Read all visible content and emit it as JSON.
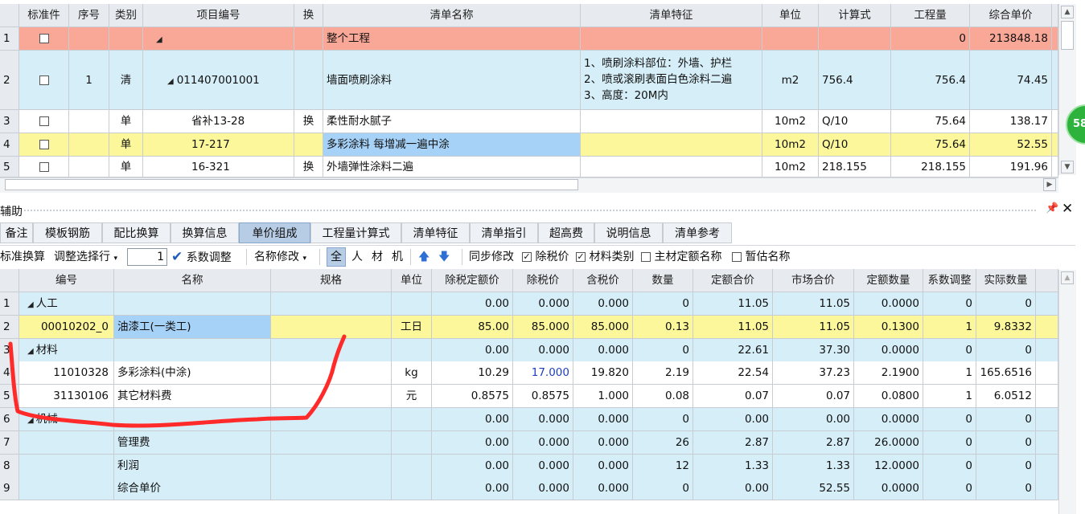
{
  "top": {
    "headers": [
      "标准件",
      "序号",
      "类别",
      "项目编号",
      "换",
      "清单名称",
      "清单特征",
      "单位",
      "计算式",
      "工程量",
      "综合单价"
    ],
    "rows": [
      {
        "rownum": "1",
        "seq": "",
        "type": "",
        "code": "",
        "swap": "",
        "name": "整个工程",
        "feature": [],
        "unit": "",
        "formula": "",
        "qty": "0",
        "price": "213848.18"
      },
      {
        "rownum": "2",
        "seq": "1",
        "type": "清",
        "code": "011407001001",
        "swap": "",
        "name": "墙面喷刷涂料",
        "feature": [
          "1、喷刷涂料部位：外墙、护栏",
          "2、喷或滚刷表面白色涂料二遍",
          "3、高度：20M内"
        ],
        "unit": "m2",
        "formula": "756.4",
        "qty": "756.4",
        "price": "74.45"
      },
      {
        "rownum": "3",
        "seq": "",
        "type": "单",
        "code": "省补13-28",
        "swap": "换",
        "name": "柔性耐水腻子",
        "feature": [],
        "unit": "10m2",
        "formula": "Q/10",
        "qty": "75.64",
        "price": "138.17"
      },
      {
        "rownum": "4",
        "seq": "",
        "type": "单",
        "code": "17-217",
        "swap": "",
        "name": "多彩涂料 每增减一遍中涂",
        "feature": [],
        "unit": "10m2",
        "formula": "Q/10",
        "qty": "75.64",
        "price": "52.55"
      },
      {
        "rownum": "5",
        "seq": "",
        "type": "单",
        "code": "16-321",
        "swap": "换",
        "name": "外墙弹性涂料二遍",
        "feature": [],
        "unit": "10m2",
        "formula": "218.155",
        "qty": "218.155",
        "price": "191.96"
      }
    ]
  },
  "badge": "58",
  "panel": {
    "title": "辅助",
    "pin_icon": "pin-icon",
    "close_icon": "close-icon"
  },
  "tabs": [
    "备注",
    "模板钢筋",
    "配比换算",
    "换算信息",
    "单价组成",
    "工程量计算式",
    "清单特征",
    "清单指引",
    "超高费",
    "说明信息",
    "清单参考"
  ],
  "active_tab": "单价组成",
  "toolbar": {
    "std_convert": "标准换算",
    "adjust_row": "调整选择行",
    "adjust_value": "1",
    "coef_adjust": "系数调整",
    "name_modify": "名称修改",
    "filters": [
      "全",
      "人",
      "材",
      "机"
    ],
    "sync_modify": "同步修改",
    "tax_price": "除税价",
    "material_cat": "材料类别",
    "main_quota_name": "主材定额名称",
    "prov_name": "暂估名称"
  },
  "bottom": {
    "headers": [
      "编号",
      "名称",
      "规格",
      "单位",
      "除税定额价",
      "除税价",
      "含税价",
      "数量",
      "定额合价",
      "市场合价",
      "定额数量",
      "系数调整",
      "实际数量"
    ],
    "rows": [
      {
        "rownum": "1",
        "code": "人工",
        "group": true,
        "name": "",
        "spec": "",
        "unit": "",
        "a": "0.00",
        "b": "0.000",
        "c": "0.000",
        "d": "0",
        "e": "11.05",
        "f": "11.05",
        "g": "0.0000",
        "h": "0",
        "i": "0"
      },
      {
        "rownum": "2",
        "code": "00010202_0",
        "group": false,
        "name": "油漆工(一类工)",
        "spec": "",
        "unit": "工日",
        "a": "85.00",
        "b": "85.000",
        "c": "85.000",
        "d": "0.13",
        "e": "11.05",
        "f": "11.05",
        "g": "0.1300",
        "h": "1",
        "i": "9.8332"
      },
      {
        "rownum": "3",
        "code": "材料",
        "group": true,
        "name": "",
        "spec": "",
        "unit": "",
        "a": "0.00",
        "b": "0.000",
        "c": "0.000",
        "d": "0",
        "e": "22.61",
        "f": "37.30",
        "g": "0.0000",
        "h": "0",
        "i": "0"
      },
      {
        "rownum": "4",
        "code": "11010328",
        "group": false,
        "name": "多彩涂料(中涂)",
        "spec": "",
        "unit": "kg",
        "a": "10.29",
        "b": "17.000",
        "c": "19.820",
        "d": "2.19",
        "e": "22.54",
        "f": "37.23",
        "g": "2.1900",
        "h": "1",
        "i": "165.6516"
      },
      {
        "rownum": "5",
        "code": "31130106",
        "group": false,
        "name": "其它材料费",
        "spec": "",
        "unit": "元",
        "a": "0.8575",
        "b": "0.8575",
        "c": "1.000",
        "d": "0.08",
        "e": "0.07",
        "f": "0.07",
        "g": "0.0800",
        "h": "1",
        "i": "6.0512"
      },
      {
        "rownum": "6",
        "code": "机械",
        "group": true,
        "name": "",
        "spec": "",
        "unit": "",
        "a": "0.00",
        "b": "0.000",
        "c": "0.000",
        "d": "0",
        "e": "0.00",
        "f": "0.00",
        "g": "0.0000",
        "h": "0",
        "i": "0"
      },
      {
        "rownum": "7",
        "code": "",
        "group": false,
        "name": "管理费",
        "spec": "",
        "unit": "",
        "a": "0.00",
        "b": "0.000",
        "c": "0.000",
        "d": "26",
        "e": "2.87",
        "f": "2.87",
        "g": "26.0000",
        "h": "0",
        "i": "0"
      },
      {
        "rownum": "8",
        "code": "",
        "group": false,
        "name": "利润",
        "spec": "",
        "unit": "",
        "a": "0.00",
        "b": "0.000",
        "c": "0.000",
        "d": "12",
        "e": "1.33",
        "f": "1.33",
        "g": "12.0000",
        "h": "0",
        "i": "0"
      },
      {
        "rownum": "9",
        "code": "",
        "group": false,
        "name": "综合单价",
        "spec": "",
        "unit": "",
        "a": "0.00",
        "b": "0.000",
        "c": "0.000",
        "d": "0",
        "e": "0.00",
        "f": "52.55",
        "g": "0.0000",
        "h": "0",
        "i": "0"
      }
    ]
  },
  "colors": {
    "top_row1": "#f9a898",
    "top_row2": "#d6eef8",
    "highlight": "#fbf79a",
    "selected": "#a6d2f7",
    "bottom_group": "#d6eef8",
    "annotation": "#ff2a2a",
    "badge": "#2db33b"
  }
}
